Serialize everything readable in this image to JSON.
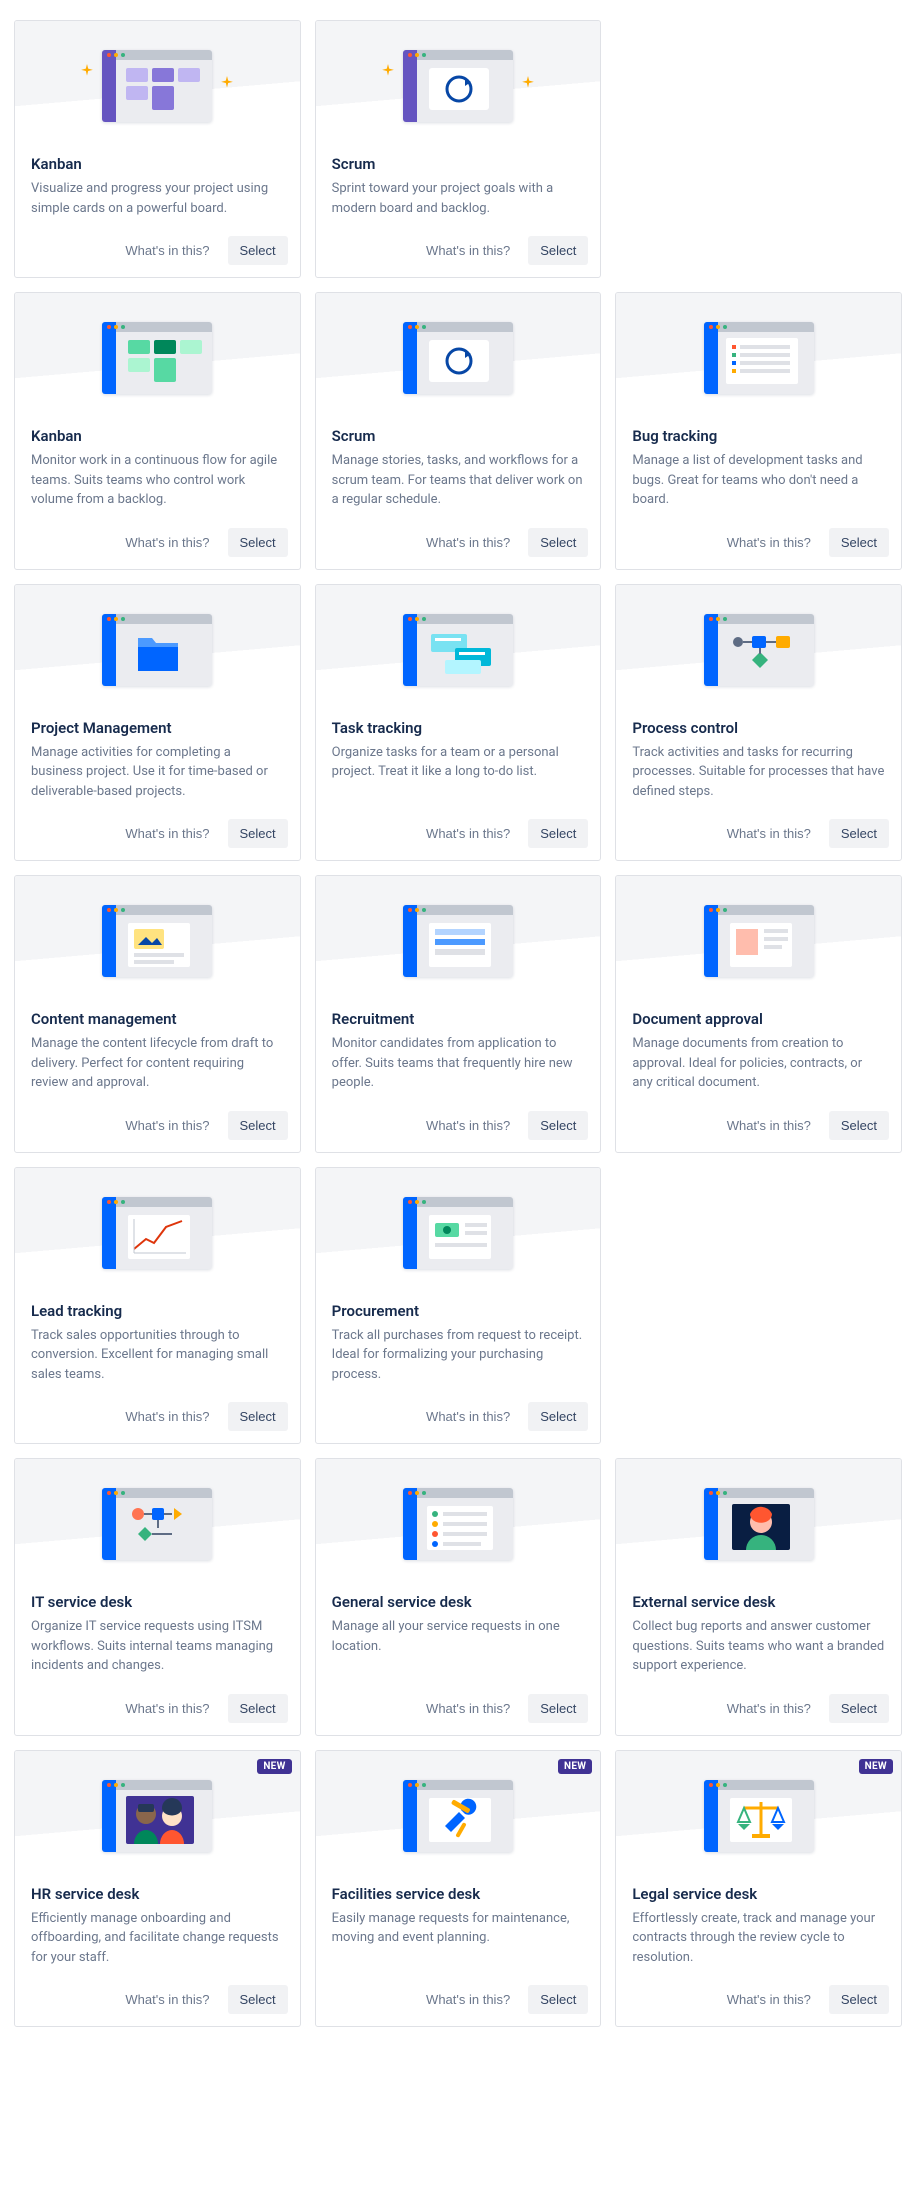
{
  "labels": {
    "whats_in": "What's in this?",
    "select": "Select",
    "new_badge": "NEW"
  },
  "cards": [
    {
      "title": "Kanban",
      "desc": "Visualize and progress your project using simple cards on a powerful board.",
      "icon": "nextgen-kanban",
      "badge": false
    },
    {
      "title": "Scrum",
      "desc": "Sprint toward your project goals with a modern board and backlog.",
      "icon": "nextgen-scrum",
      "badge": false
    },
    {
      "title": "",
      "desc": "",
      "icon": "empty",
      "badge": false
    },
    {
      "title": "Kanban",
      "desc": "Monitor work in a continuous flow for agile teams. Suits teams who control work volume from a backlog.",
      "icon": "kanban",
      "badge": false
    },
    {
      "title": "Scrum",
      "desc": "Manage stories, tasks, and workflows for a scrum team. For teams that deliver work on a regular schedule.",
      "icon": "scrum",
      "badge": false
    },
    {
      "title": "Bug tracking",
      "desc": "Manage a list of development tasks and bugs. Great for teams who don't need a board.",
      "icon": "bug-tracking",
      "badge": false
    },
    {
      "title": "Project Management",
      "desc": "Manage activities for completing a business project. Use it for time-based or deliverable-based projects.",
      "icon": "project-mgmt",
      "badge": false
    },
    {
      "title": "Task tracking",
      "desc": "Organize tasks for a team or a personal project. Treat it like a long to-do list.",
      "icon": "task-tracking",
      "badge": false
    },
    {
      "title": "Process control",
      "desc": "Track activities and tasks for recurring processes. Suitable for processes that have defined steps.",
      "icon": "process-control",
      "badge": false
    },
    {
      "title": "Content management",
      "desc": "Manage the content lifecycle from draft to delivery. Perfect for content requiring review and approval.",
      "icon": "content-mgmt",
      "badge": false
    },
    {
      "title": "Recruitment",
      "desc": "Monitor candidates from application to offer. Suits teams that frequently hire new people.",
      "icon": "recruitment",
      "badge": false
    },
    {
      "title": "Document approval",
      "desc": "Manage documents from creation to approval. Ideal for policies, contracts, or any critical document.",
      "icon": "doc-approval",
      "badge": false
    },
    {
      "title": "Lead tracking",
      "desc": "Track sales opportunities through to conversion. Excellent for managing small sales teams.",
      "icon": "lead-tracking",
      "badge": false
    },
    {
      "title": "Procurement",
      "desc": "Track all purchases from request to receipt. Ideal for formalizing your purchasing process.",
      "icon": "procurement",
      "badge": false
    },
    {
      "title": "",
      "desc": "",
      "icon": "empty",
      "badge": false
    },
    {
      "title": "IT service desk",
      "desc": "Organize IT service requests using ITSM workflows. Suits internal teams managing incidents and changes.",
      "icon": "it-service",
      "badge": false
    },
    {
      "title": "General service desk",
      "desc": "Manage all your service requests in one location.",
      "icon": "general-service",
      "badge": false
    },
    {
      "title": "External service desk",
      "desc": "Collect bug reports and answer customer questions. Suits teams who want a branded support experience.",
      "icon": "external-service",
      "badge": false
    },
    {
      "title": "HR service desk",
      "desc": "Efficiently manage onboarding and offboarding, and facilitate change requests for your staff.",
      "icon": "hr-service",
      "badge": true
    },
    {
      "title": "Facilities service desk",
      "desc": "Easily manage requests for maintenance, moving and event planning.",
      "icon": "facilities-service",
      "badge": true
    },
    {
      "title": "Legal service desk",
      "desc": "Effortlessly create, track and manage your contracts through the review cycle to resolution.",
      "icon": "legal-service",
      "badge": true
    }
  ]
}
